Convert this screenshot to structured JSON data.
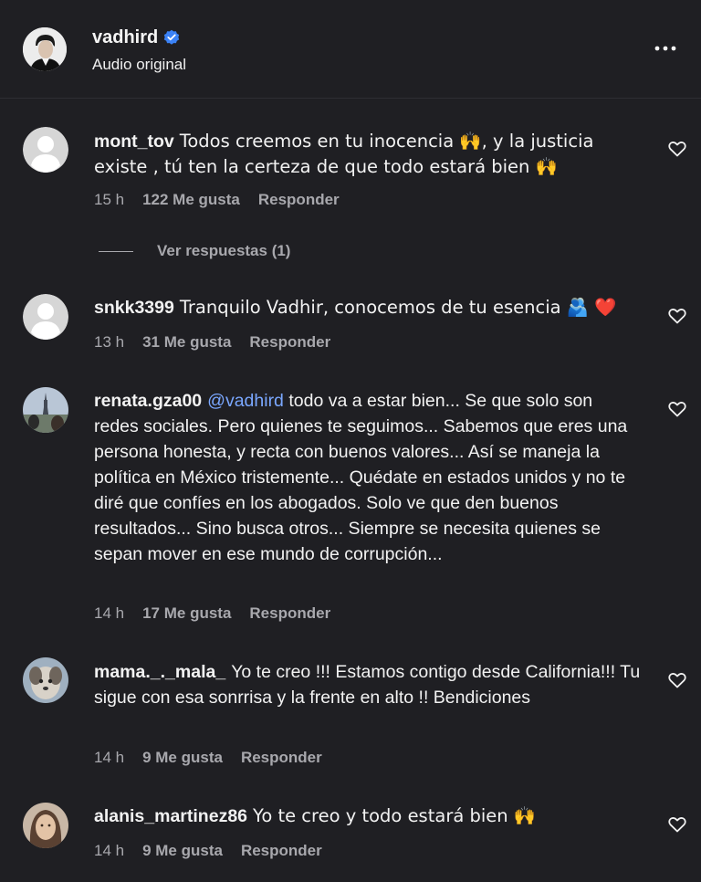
{
  "header": {
    "username": "vadhird",
    "subtitle": "Audio original",
    "icons": {
      "verified": "verified-badge-icon",
      "more": "more-options-icon"
    }
  },
  "colors": {
    "background": "#1f1f23",
    "text": "#f5f5f5",
    "muted": "#a8a8ad",
    "mention": "#7aa7ff",
    "verified": "#3b82f6"
  },
  "comments": [
    {
      "username": "mont_tov",
      "text": "Todos creemos en tu inocencia 🙌, y la justicia existe , tú ten la certeza de que todo estará bien 🙌",
      "time": "15 h",
      "likes": "122 Me gusta",
      "reply": "Responder",
      "view_replies": "Ver respuestas (1)"
    },
    {
      "username": "snkk3399",
      "text": "Tranquilo Vadhir, conocemos de tu esencia 🫂 ❤️",
      "time": "13 h",
      "likes": "31 Me gusta",
      "reply": "Responder"
    },
    {
      "username": "renata.gza00",
      "mention": "@vadhird",
      "text": " todo va a estar bien... Se que solo son redes sociales. Pero quienes te seguimos... Sabemos que eres una persona honesta, y recta con buenos valores... Así se maneja la política en México tristemente... Quédate en estados unidos y no te diré que confíes en los abogados. Solo ve que den buenos resultados... Sino busca otros... Siempre se necesita quienes se sepan mover en ese mundo de corrupción...",
      "time": "14 h",
      "likes": "17 Me gusta",
      "reply": "Responder"
    },
    {
      "username": "mama._._mala_",
      "text": "Yo te creo !!! Estamos contigo desde California!!! Tu sigue con esa sonrrisa y la frente en alto !! Bendiciones",
      "time": "14 h",
      "likes": "9 Me gusta",
      "reply": "Responder"
    },
    {
      "username": "alanis_martinez86",
      "text": "Yo te creo y todo estará bien 🙌",
      "time": "14 h",
      "likes": "9 Me gusta",
      "reply": "Responder"
    }
  ]
}
